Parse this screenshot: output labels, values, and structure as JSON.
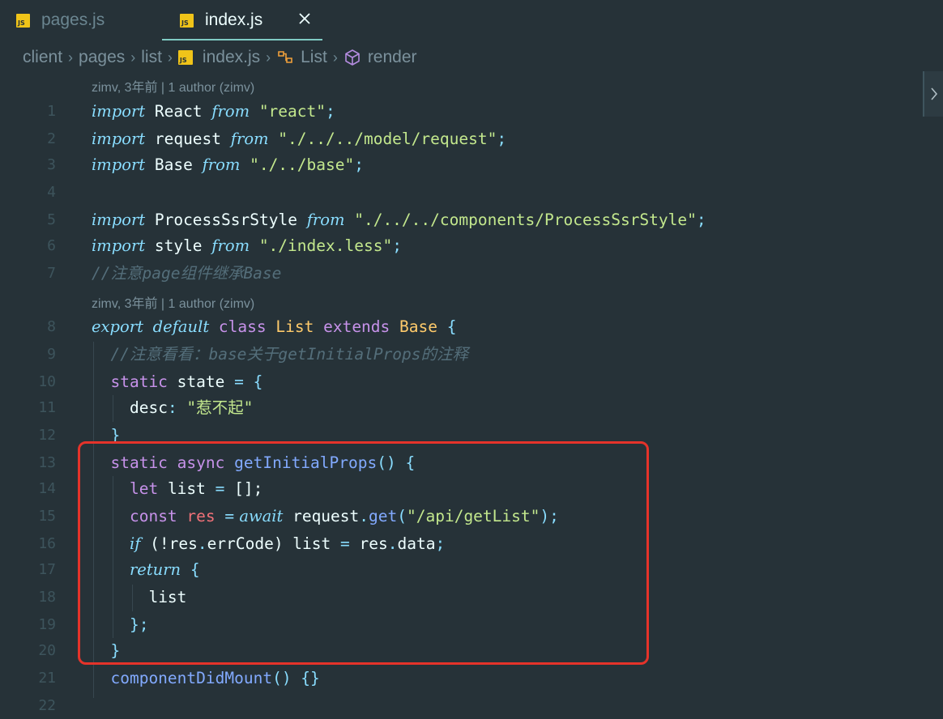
{
  "tabs": [
    {
      "label": "pages.js",
      "icon": "js-file-icon",
      "active": false
    },
    {
      "label": "index.js",
      "icon": "js-file-icon",
      "active": true
    }
  ],
  "breadcrumb": {
    "items": [
      "client",
      "pages",
      "list",
      "index.js",
      "List",
      "render"
    ]
  },
  "codelens": [
    "zimv, 3年前 | 1 author (zimv)",
    "zimv, 3年前 | 1 author (zimv)"
  ],
  "code": {
    "line_numbers": [
      "1",
      "2",
      "3",
      "4",
      "5",
      "6",
      "7",
      "8",
      "9",
      "10",
      "11",
      "12",
      "13",
      "14",
      "15",
      "16",
      "17",
      "18",
      "19",
      "20",
      "21",
      "22"
    ],
    "l1": {
      "kw1": "import",
      "id": " React ",
      "kw2": "from",
      "str": " \"react\"",
      "end": ";"
    },
    "l2": {
      "kw1": "import",
      "id": " request ",
      "kw2": "from",
      "str": " \"./../../model/request\"",
      "end": ";"
    },
    "l3": {
      "kw1": "import",
      "id": " Base ",
      "kw2": "from",
      "str": " \"./../base\"",
      "end": ";"
    },
    "l5": {
      "kw1": "import",
      "id": " ProcessSsrStyle ",
      "kw2": "from",
      "str": " \"./../../components/ProcessSsrStyle\"",
      "end": ";"
    },
    "l6": {
      "kw1": "import",
      "id": " style ",
      "kw2": "from",
      "str": " \"./index.less\"",
      "end": ";"
    },
    "l7": {
      "comment": "//注意page组件继承Base"
    },
    "l8": {
      "kw1": "export",
      "kw2": "default",
      "kw3": "class",
      "name": "List",
      "kw4": "extends",
      "base": "Base",
      "brace": "{"
    },
    "l9": {
      "comment": "//注意看看：base关于getInitialProps的注释"
    },
    "l10": {
      "kw": "static",
      "id": " state ",
      "op": "=",
      "brace": " {"
    },
    "l11": {
      "key": "desc",
      "colon": ":",
      "str": " \"惹不起\""
    },
    "l12": {
      "brace": "}"
    },
    "l13": {
      "kw1": "static",
      "kw2": " async",
      "fn": " getInitialProps",
      "paren": "()",
      "brace": " {"
    },
    "l14": {
      "kw": "let",
      "id": " list ",
      "op": "=",
      "rest": " [];"
    },
    "l15": {
      "kw": "const",
      "var": " res ",
      "op": "=",
      "await": " await",
      "obj": " request",
      "dot": ".",
      "fn": "get",
      "p1": "(",
      "str": "\"/api/getList\"",
      "p2": ");"
    },
    "l16": {
      "kw": "if",
      "a": " (!res",
      "dot1": ".",
      "b": "errCode) list ",
      "op": "=",
      "c": " res",
      "dot2": ".",
      "d": "data",
      "end": ";"
    },
    "l17": {
      "kw": "return",
      "brace": " {"
    },
    "l18": {
      "id": "list"
    },
    "l19": {
      "brace": "}",
      "end": ";"
    },
    "l20": {
      "brace": "}"
    },
    "l21": {
      "fn": "componentDidMount",
      "paren": "()",
      "brace": " {}"
    }
  },
  "colors": {
    "highlight_border": "#e5332a",
    "background": "#263238",
    "tab_underline": "#80cbc4"
  }
}
